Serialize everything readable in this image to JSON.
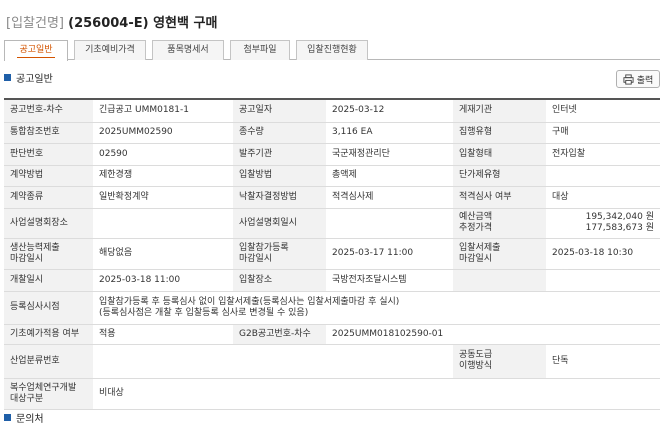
{
  "header": {
    "prefix": "[입찰건명]",
    "title": "(256004-E) 영현백 구매"
  },
  "tabs": [
    {
      "label": "공고일반"
    },
    {
      "label": "기초예비가격"
    },
    {
      "label": "품목명세서"
    },
    {
      "label": "첨부파일"
    },
    {
      "label": "입찰진행현황"
    }
  ],
  "section": {
    "title": "공고일반",
    "print_label": "출력"
  },
  "rows": [
    [
      "공고번호-차수",
      "긴급공고 UMM0181-1",
      "공고일자",
      "2025-03-12",
      "게재기관",
      "인터넷"
    ],
    [
      "통합참조번호",
      "2025UMM02590",
      "종수량",
      "3,116 EA",
      "집행유형",
      "구매"
    ],
    [
      "판단번호",
      "02590",
      "발주기관",
      "국군재정관리단",
      "입찰형태",
      "전자입찰"
    ],
    [
      "계약방법",
      "제한경쟁",
      "입찰방법",
      "총액제",
      "단가제유형",
      ""
    ],
    [
      "계약종류",
      "일반확정계약",
      "낙찰자결정방법",
      "적격심사제",
      "적격심사 여부",
      "대상"
    ],
    [
      "사업설명회장소",
      "",
      "사업설명회일시",
      "",
      "예산금액\n추정가격",
      "195,342,040 원\n177,583,673 원"
    ],
    [
      "생산능력제출\n마감일시",
      "해당없음",
      "입찰참가등록\n마감일시",
      "2025-03-17 11:00",
      "입찰서제출\n마감일시",
      "2025-03-18 10:30"
    ],
    [
      "개찰일시",
      "2025-03-18 11:00",
      "입찰장소",
      "국방전자조달시스템",
      "",
      ""
    ],
    [
      "등록심사시점",
      "입찰참가등록 후 등록심사 없이 입찰서제출(등록심사는 입찰서제출마감 후 실시)\n(등록심사점은 개찰 후 입찰등록 심사로 변경될 수 있음)"
    ],
    [
      "기초예가적용 여부",
      "적용",
      "G2B공고번호-차수",
      "2025UMM018102590-01"
    ],
    [
      "산업분류번호",
      "",
      "공동도급\n이행방식",
      "단독"
    ],
    [
      "복수업체연구개발\n대상구분",
      "비대상"
    ]
  ],
  "footer": {
    "title": "문의처"
  },
  "colors": {
    "accent": "#d35400",
    "bullet": "#1f5fa8",
    "header_bg": "#f2f2f2"
  }
}
